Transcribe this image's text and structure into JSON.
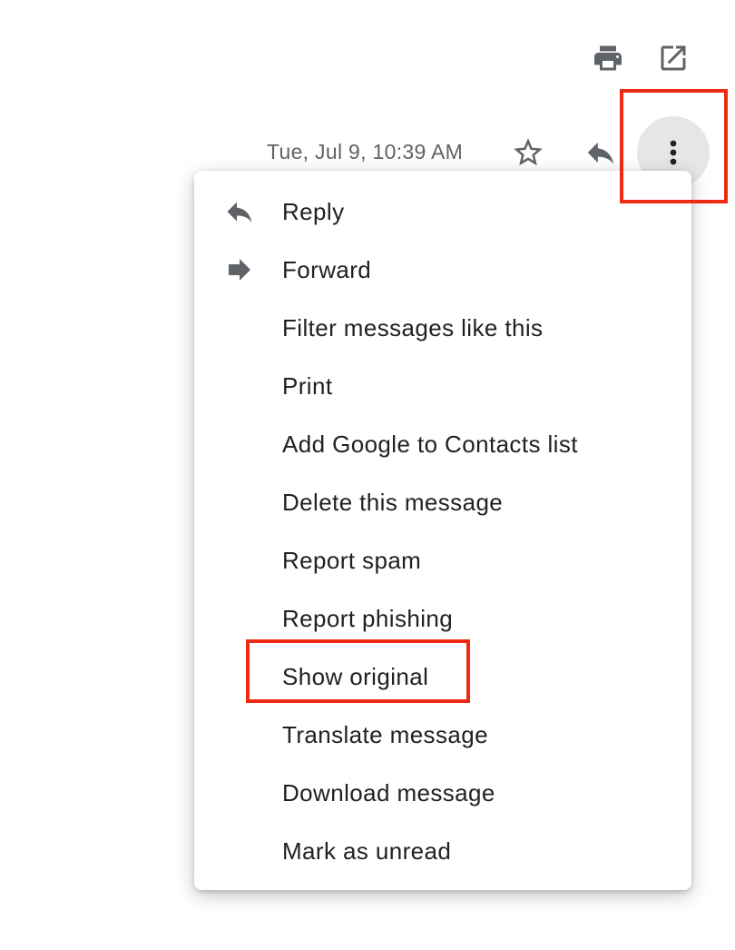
{
  "toolbar": {
    "print_icon": "print-icon",
    "open_new_window_icon": "open-in-new-window-icon"
  },
  "message_header": {
    "timestamp": "Tue, Jul 9, 10:39 AM",
    "star_icon": "star-outline-icon",
    "reply_icon": "reply-icon",
    "more_icon": "more-vertical-icon"
  },
  "menu": {
    "items": [
      {
        "label": "Reply",
        "icon": "reply-icon"
      },
      {
        "label": "Forward",
        "icon": "forward-icon"
      },
      {
        "label": "Filter messages like this"
      },
      {
        "label": "Print"
      },
      {
        "label": "Add Google to Contacts list"
      },
      {
        "label": "Delete this message"
      },
      {
        "label": "Report spam"
      },
      {
        "label": "Report phishing"
      },
      {
        "label": "Show original"
      },
      {
        "label": "Translate message"
      },
      {
        "label": "Download message"
      },
      {
        "label": "Mark as unread"
      }
    ]
  },
  "annotations": {
    "highlight_color": "#ee2b12",
    "highlighted_items": [
      "more-options-button",
      "Show original"
    ]
  },
  "colors": {
    "icon_gray": "#5f6368",
    "text_dark": "#202124",
    "button_hover_bg": "#e6e6e6"
  }
}
